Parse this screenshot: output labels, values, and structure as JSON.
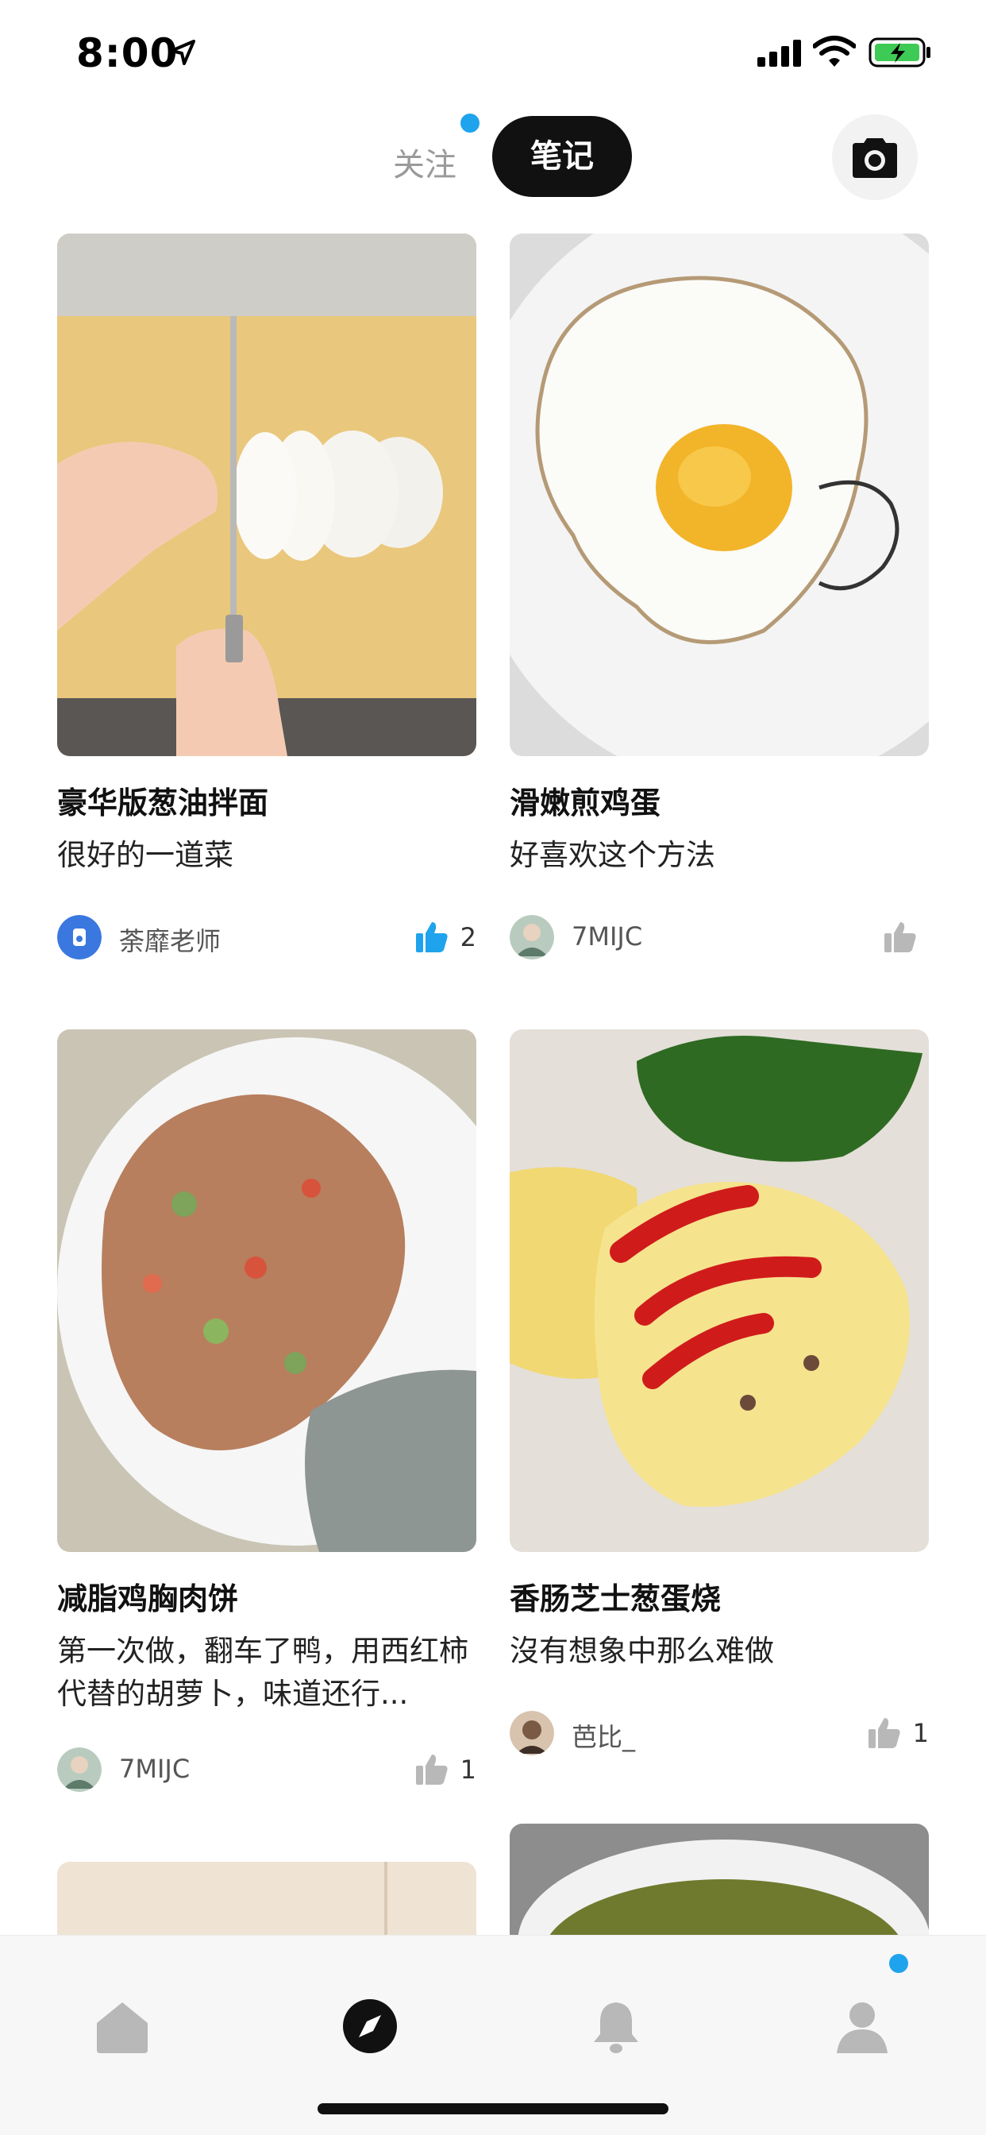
{
  "status_bar": {
    "time": "8:00",
    "icons": [
      "location-arrow-icon",
      "cellular-signal-icon",
      "wifi-icon",
      "battery-charging-icon"
    ]
  },
  "header": {
    "tabs": [
      {
        "label": "关注",
        "active": false,
        "has_dot": true
      },
      {
        "label": "笔记",
        "active": true
      }
    ],
    "camera_icon": "camera-icon"
  },
  "feed": {
    "cards": [
      {
        "title": "豪华版葱油拌面",
        "description": "很好的一道菜",
        "author": "荼靡老师",
        "likes": "2",
        "liked": true,
        "image": "knife-cutting-white-cake-photo"
      },
      {
        "title": "滑嫩煎鸡蛋",
        "description": "好喜欢这个方法",
        "author": "7MIJC",
        "likes": "",
        "liked": false,
        "image": "fried-egg-on-plate-photo"
      },
      {
        "title": "减脂鸡胸肉饼",
        "description": "第一次做，翻车了鸭，用西红柿代替的胡萝卜，味道还行...",
        "author": "7MIJC",
        "likes": "1",
        "liked": false,
        "image": "chicken-breast-patty-plate-photo"
      },
      {
        "title": "香肠芝士葱蛋烧",
        "description": "沒有想象中那么难做",
        "author": "芭比_",
        "likes": "1",
        "liked": false,
        "image": "omelette-with-ketchup-photo"
      }
    ]
  },
  "tabbar": {
    "items": [
      {
        "icon": "home-icon",
        "active": false
      },
      {
        "icon": "compass-icon",
        "active": true
      },
      {
        "icon": "bell-icon",
        "active": false
      },
      {
        "icon": "profile-icon",
        "active": false,
        "has_dot": true
      }
    ]
  },
  "colors": {
    "accent": "#1fa3ec",
    "active_tab_bg": "#111111",
    "inactive_icon": "#b8b8b8"
  }
}
